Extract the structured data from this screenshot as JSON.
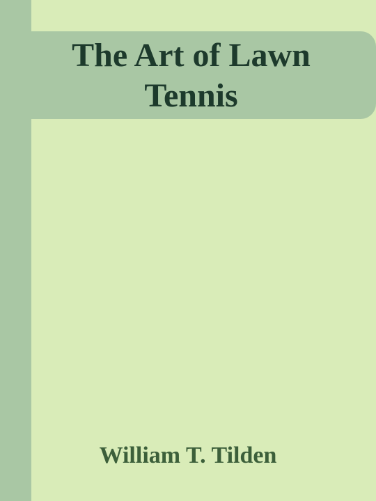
{
  "cover": {
    "title_line1": "The Art of Lawn",
    "title_line2": "Tennis",
    "author": "William T. Tilden"
  },
  "colors": {
    "background": "#d9ecb8",
    "band": "#a9c7a4",
    "title_text": "#1d3a2c",
    "author_text": "#3c5f3a"
  }
}
